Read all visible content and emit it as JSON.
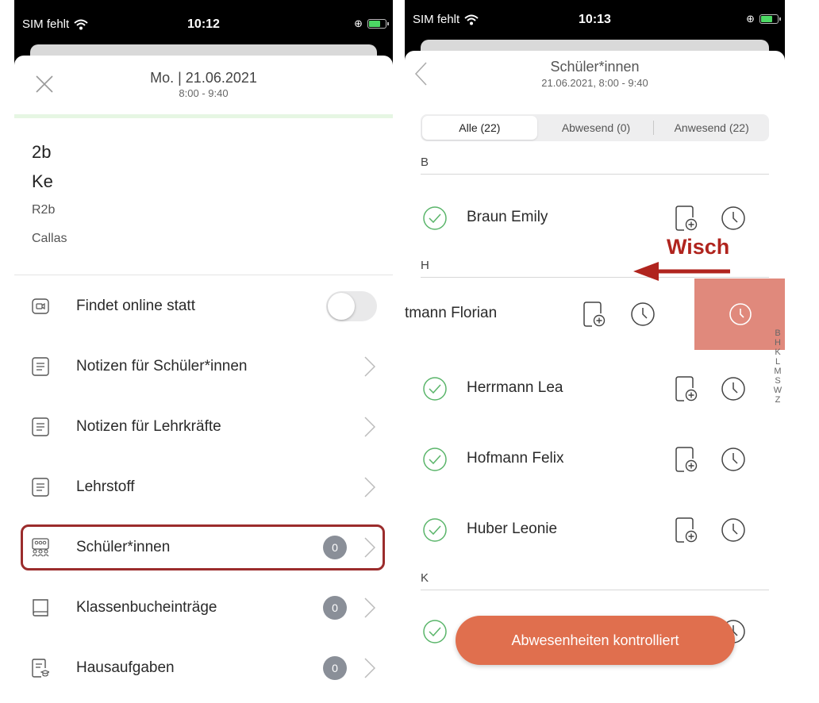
{
  "colors": {
    "accent_cta": "#e06f4e",
    "swipe_action": "#e0897c",
    "annotation_red": "#b0241e",
    "badge": "#8a8f98",
    "present_green": "#5ab56a"
  },
  "left": {
    "status": {
      "carrier": "SIM fehlt",
      "time": "10:12"
    },
    "header": {
      "title": "Mo. | 21.06.2021",
      "subtitle": "8:00 - 9:40"
    },
    "info": {
      "class": "2b",
      "subject": "Ke",
      "room": "R2b",
      "teacher": "Callas"
    },
    "menu": [
      {
        "label": "Findet online statt",
        "icon": "video-icon"
      },
      {
        "label": "Notizen für Schüler*innen",
        "icon": "note-icon"
      },
      {
        "label": "Notizen für Lehrkräfte",
        "icon": "note-icon"
      },
      {
        "label": "Lehrstoff",
        "icon": "note-icon"
      },
      {
        "label": "Schüler*innen",
        "icon": "students-icon",
        "badge": "0"
      },
      {
        "label": "Klassenbucheinträge",
        "icon": "book-icon",
        "badge": "0"
      },
      {
        "label": "Hausaufgaben",
        "icon": "homework-icon",
        "badge": "0"
      }
    ]
  },
  "right": {
    "status": {
      "carrier": "SIM fehlt",
      "time": "10:13"
    },
    "header": {
      "title": "Schüler*innen",
      "subtitle": "21.06.2021, 8:00 - 9:40"
    },
    "segments": [
      "Alle (22)",
      "Abwesend (0)",
      "Anwesend (22)"
    ],
    "sections": [
      "B",
      "H",
      "K"
    ],
    "students": [
      "Braun Emily",
      "tmann Florian",
      "Herrmann Lea",
      "Hofmann Felix",
      "Huber Leonie"
    ],
    "index": [
      "B",
      "H",
      "K",
      "L",
      "M",
      "S",
      "W",
      "Z"
    ],
    "cta": "Abwesenheiten kontrolliert"
  },
  "annotation": {
    "label": "Wisch"
  }
}
